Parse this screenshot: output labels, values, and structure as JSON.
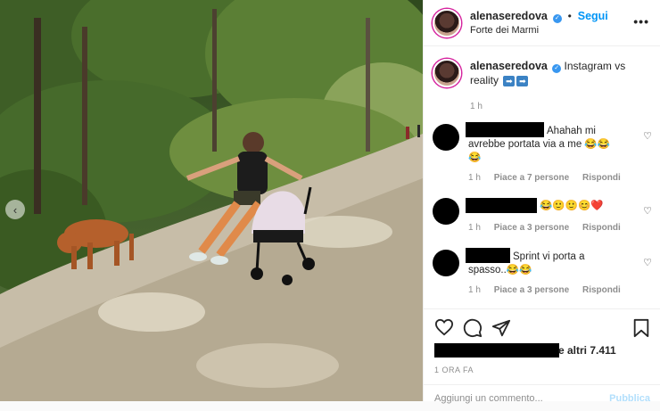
{
  "post": {
    "username": "alenaseredova",
    "verified_symbol": "✓",
    "dot": "•",
    "follow_label": "Segui",
    "location": "Forte dei Marmi",
    "more_label": "•••",
    "prev_label": "‹"
  },
  "caption": {
    "username": "alenaseredova",
    "text": "Instagram vs reality",
    "emoji": [
      "➡",
      "➡"
    ],
    "time": "1 h"
  },
  "comments": [
    {
      "text": "Ahahah mi avrebbe portata via a me 😂😂😂",
      "time": "1 h",
      "likes": "Piace a 7 persone",
      "reply": "Rispondi"
    },
    {
      "text": "😂🙂🙂😊❤️",
      "time": "1 h",
      "likes": "Piace a 3 persone",
      "reply": "Rispondi"
    },
    {
      "text": "Sprint vi porta a spasso..😂😂",
      "time": "1 h",
      "likes": "Piace a 3 persone",
      "reply": "Rispondi"
    }
  ],
  "likes_text": "e altri 7.411",
  "posted_ago": "1 ORA FA",
  "add_comment": {
    "placeholder": "Aggiungi un commento...",
    "publish_label": "Pubblica"
  },
  "icons": [
    "heart-icon",
    "comment-icon",
    "share-icon",
    "bookmark-icon",
    "more-icon",
    "chevron-left-icon"
  ],
  "colors": {
    "link": "#0095f6",
    "muted": "#8e8e8e",
    "publish_disabled": "#b2dffc",
    "verified": "#3897f0"
  }
}
